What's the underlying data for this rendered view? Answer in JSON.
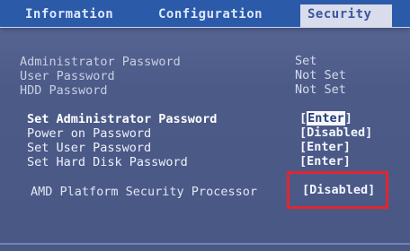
{
  "tabs": [
    {
      "label": "Information"
    },
    {
      "label": "Configuration"
    },
    {
      "label": "Security",
      "selected": true
    }
  ],
  "status": [
    {
      "label": "Administrator Password",
      "value": "Set"
    },
    {
      "label": "User Password",
      "value": "Not Set"
    },
    {
      "label": "HDD Password",
      "value": "Not Set"
    }
  ],
  "menu": [
    {
      "label": "Set Administrator Password",
      "value": "Enter",
      "selected": true
    },
    {
      "label": "Power on Password",
      "value": "[Disabled]"
    },
    {
      "label": "Set User Password",
      "value": "[Enter]"
    },
    {
      "label": "Set Hard Disk Password",
      "value": "[Enter]"
    }
  ],
  "amd": {
    "label": "AMD Platform Security Processor",
    "value": "[Disabled]"
  },
  "colors": {
    "background": "#4f5e8c",
    "tab_bar": "#2b5aa8",
    "selected_tab": "#d9dcea",
    "highlight_box": "#e2262e"
  }
}
